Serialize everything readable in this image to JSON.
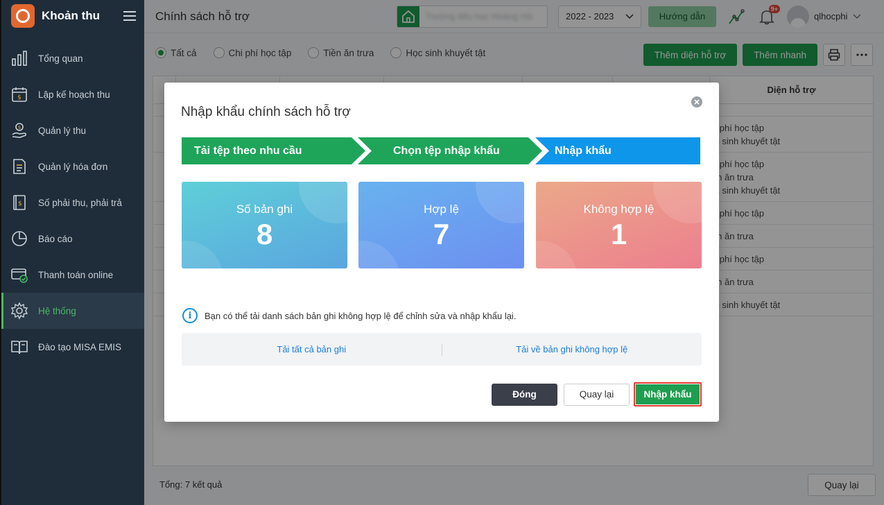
{
  "app": {
    "title": "Khoản thu"
  },
  "sidebar": {
    "items": [
      {
        "label": "Tổng quan",
        "icon": "bar-chart-icon"
      },
      {
        "label": "Lập kế hoạch thu",
        "icon": "calendar-dollar-icon"
      },
      {
        "label": "Quản lý thu",
        "icon": "hand-coin-icon"
      },
      {
        "label": "Quản lý hóa đơn",
        "icon": "invoice-icon"
      },
      {
        "label": "Số phải thu, phải trả",
        "icon": "ledger-icon"
      },
      {
        "label": "Báo cáo",
        "icon": "pie-chart-icon"
      },
      {
        "label": "Thanh toán online",
        "icon": "card-check-icon"
      },
      {
        "label": "Hệ thống",
        "icon": "gear-icon",
        "active": true
      },
      {
        "label": "Đào tạo MISA EMIS",
        "icon": "book-icon"
      }
    ]
  },
  "topbar": {
    "page_title": "Chính sách hỗ trợ",
    "school_name": "Trường tiểu học Hoàng Hà",
    "year": "2022 - 2023",
    "guide_label": "Hướng dẫn",
    "notification_count": "9+",
    "username": "qlhocphi"
  },
  "filters": {
    "options": [
      "Tất cả",
      "Chi phí học tập",
      "Tiền ăn trưa",
      "Học sinh khuyết tật"
    ],
    "selected": "Tất cả"
  },
  "toolbar": {
    "add_label": "Thêm diện hỗ trợ",
    "quick_add_label": "Thêm nhanh"
  },
  "grid": {
    "last_column_header": "Diện hỗ trợ",
    "rows": [
      [
        "hi phí học tập",
        "ọc sinh khuyết tật"
      ],
      [
        "hi phí học tập",
        "iền ăn trưa",
        "ọc sinh khuyết tật"
      ],
      [
        "hi phí học tập"
      ],
      [
        "iền ăn trưa"
      ],
      [
        "hi phí học tập"
      ],
      [
        "iền ăn trưa"
      ],
      [
        "ọc sinh khuyết tật"
      ]
    ]
  },
  "footer": {
    "total_label": "Tổng:",
    "total_value": "7 kết quả",
    "back_label": "Quay lại"
  },
  "modal": {
    "title": "Nhập khẩu chính sách hỗ trợ",
    "steps": [
      "Tải tệp theo nhu cầu",
      "Chọn tệp nhập khẩu",
      "Nhập khẩu"
    ],
    "cards": [
      {
        "label": "Số bản ghi",
        "value": "8"
      },
      {
        "label": "Hợp lệ",
        "value": "7"
      },
      {
        "label": "Không hợp lệ",
        "value": "1"
      }
    ],
    "info_text": "Bạn có thể tải danh sách bản ghi không hợp lệ để chỉnh sửa và nhập khẩu lại.",
    "download_all": "Tải tất cả bản ghi",
    "download_invalid": "Tải về bản ghi không hợp lệ",
    "close_label": "Đóng",
    "back_label": "Quay lại",
    "import_label": "Nhập khẩu"
  },
  "colors": {
    "sidebar_bg": "#1f2d3a",
    "primary_green": "#1e9e50",
    "step_active_blue": "#0e96ea",
    "card_total": "#4fc0d6",
    "card_valid": "#6b9ef0",
    "card_invalid": "#ee8f90"
  }
}
